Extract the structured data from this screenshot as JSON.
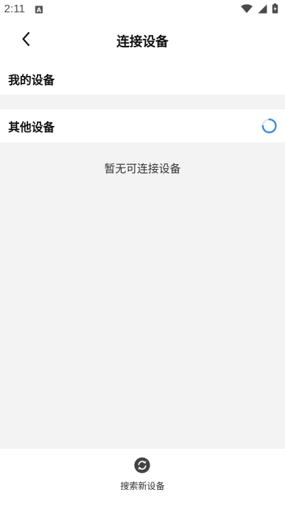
{
  "status_bar": {
    "time": "2:11",
    "icons": [
      "notification-a-icon",
      "wifi-icon",
      "signal-icon",
      "battery-icon"
    ]
  },
  "header": {
    "title": "连接设备",
    "back_icon": "chevron-left-icon"
  },
  "sections": {
    "my_devices": {
      "title": "我的设备"
    },
    "other_devices": {
      "title": "其他设备",
      "status_icon": "loading-spinner-icon"
    }
  },
  "content": {
    "empty_message": "暂无可连接设备"
  },
  "bottom_bar": {
    "search_label": "搜索新设备",
    "search_icon": "refresh-icon"
  },
  "colors": {
    "background": "#ffffff",
    "band": "#f3f3f3",
    "spinner": "#3a8bd8",
    "icon_dark": "#444444"
  }
}
